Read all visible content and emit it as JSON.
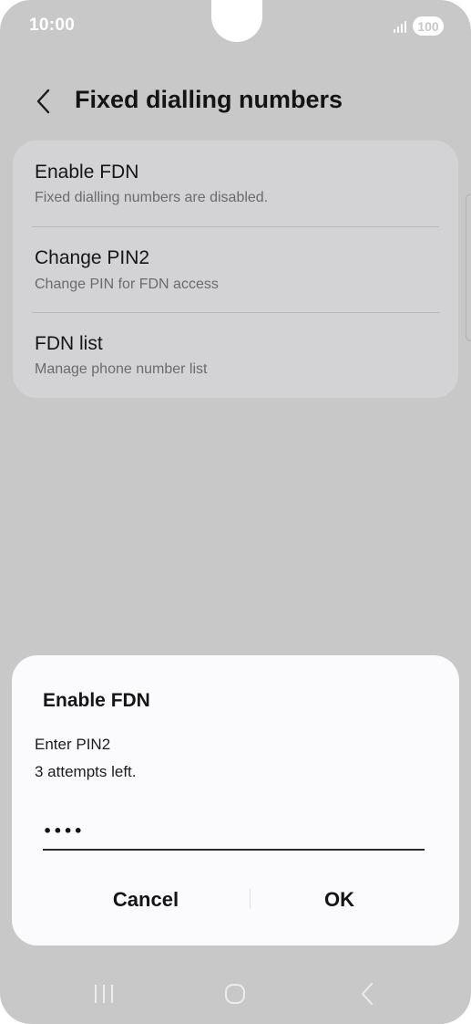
{
  "status_bar": {
    "time": "10:00",
    "battery": "100",
    "signal_icon": "signal-icon"
  },
  "header": {
    "title": "Fixed dialling numbers",
    "back_icon": "chevron-left-icon"
  },
  "settings": {
    "items": [
      {
        "title": "Enable FDN",
        "subtitle": "Fixed dialling numbers are disabled."
      },
      {
        "title": "Change PIN2",
        "subtitle": "Change PIN for FDN access"
      },
      {
        "title": "FDN list",
        "subtitle": "Manage phone number list"
      }
    ]
  },
  "dialog": {
    "title": "Enable FDN",
    "message_line1": "Enter PIN2",
    "message_line2": "3 attempts left.",
    "pin_value": "••••",
    "cancel_label": "Cancel",
    "ok_label": "OK"
  },
  "nav_bar": {
    "icons": [
      "recents-icon",
      "home-icon",
      "back-icon"
    ]
  },
  "colors": {
    "screen_background": "#c8c8c8",
    "card_background": "#d3d3d5",
    "dialog_background": "#fbfbfd",
    "text_primary": "#141414",
    "text_secondary": "#6b6b6b"
  }
}
